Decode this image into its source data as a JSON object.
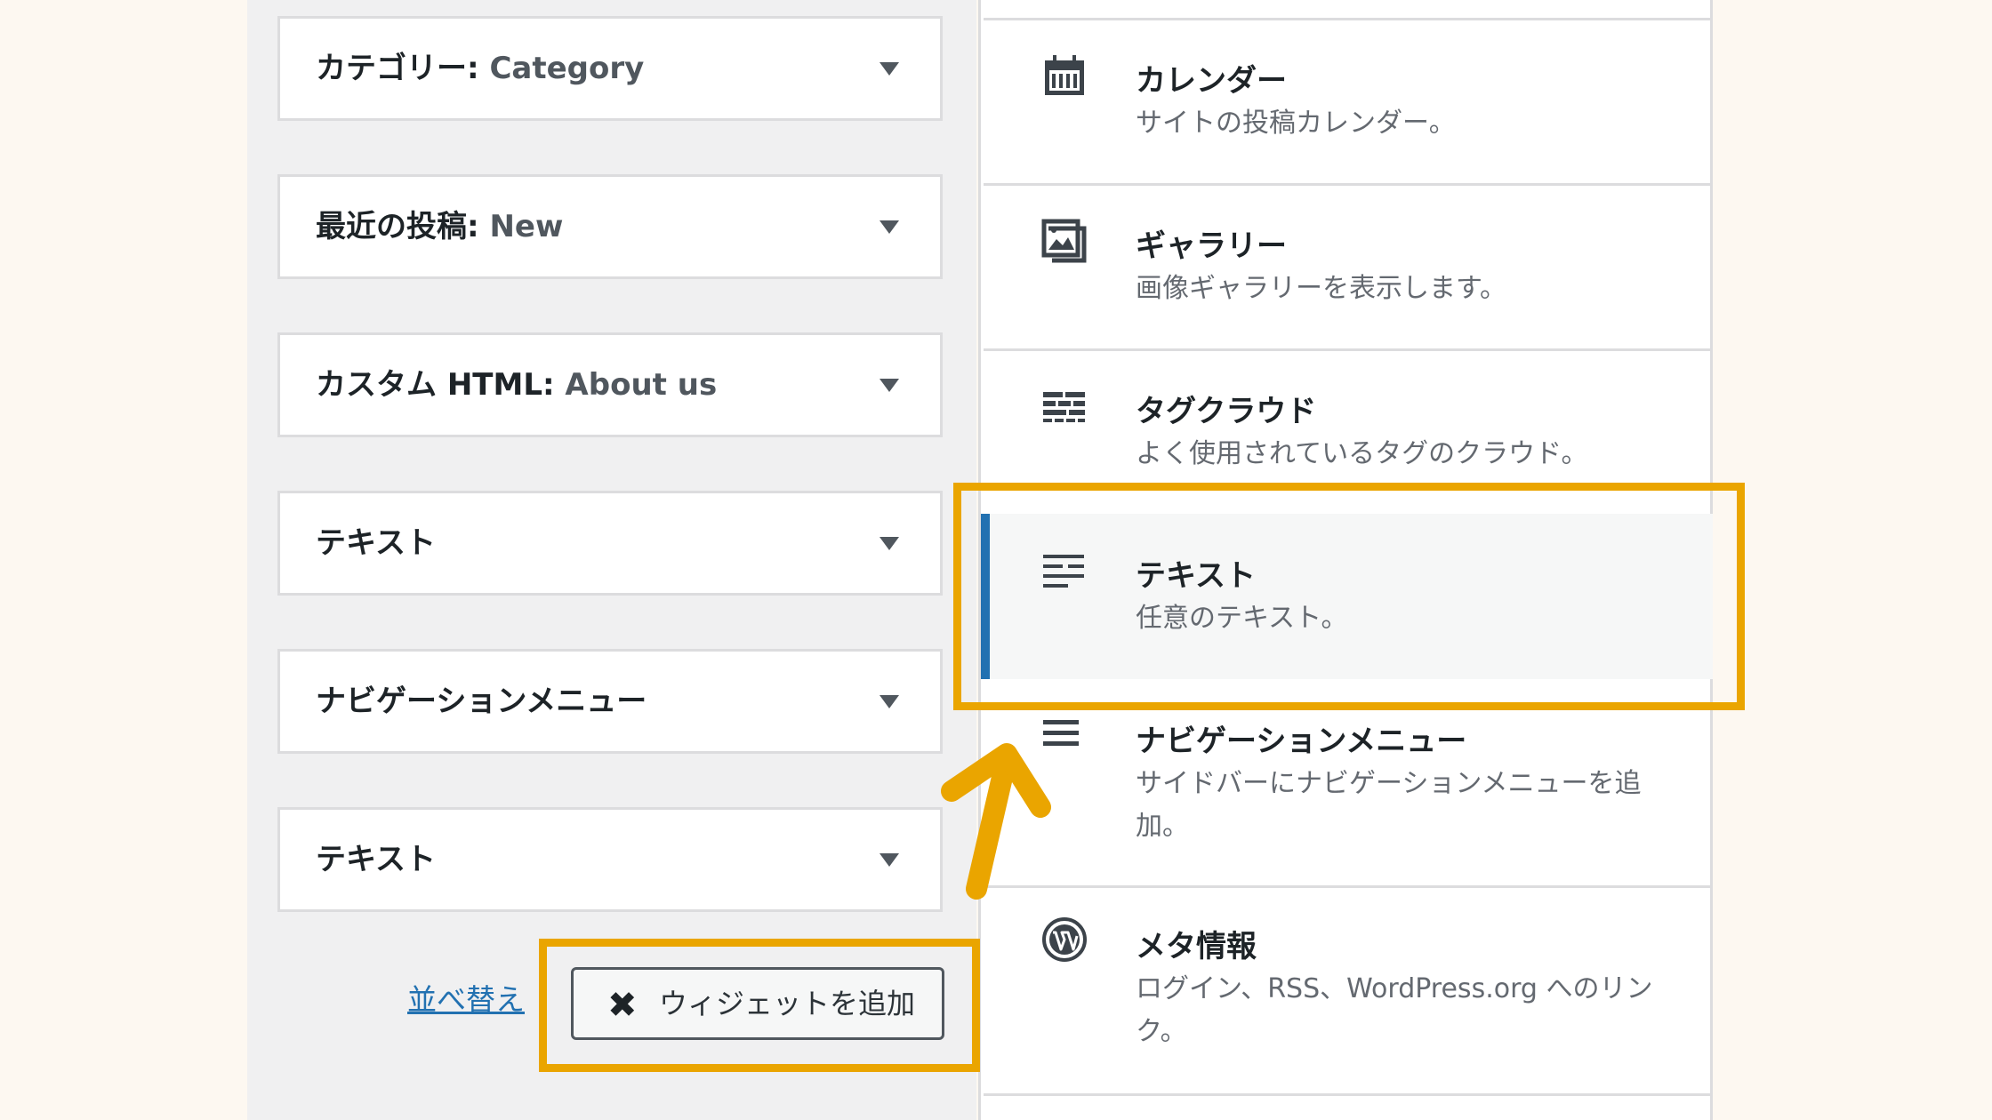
{
  "widgets": [
    {
      "type": "カテゴリー",
      "separator": ":",
      "title": " Category"
    },
    {
      "type": "最近の投稿",
      "separator": ":",
      "title": " New"
    },
    {
      "type": "カスタム HTML",
      "separator": ":",
      "title": " About us"
    },
    {
      "type": "テキスト",
      "separator": "",
      "title": ""
    },
    {
      "type": "ナビゲーションメニュー",
      "separator": "",
      "title": ""
    },
    {
      "type": "テキスト",
      "separator": "",
      "title": ""
    }
  ],
  "actions": {
    "reorder_label": "並べ替え",
    "add_widget_label": "ウィジェットを追加",
    "close_glyph": "✖"
  },
  "widget_choices": [
    {
      "icon": "calendar-icon",
      "name": "カレンダー",
      "desc": "サイトの投稿カレンダー。"
    },
    {
      "icon": "gallery-icon",
      "name": "ギャラリー",
      "desc": "画像ギャラリーを表示します。"
    },
    {
      "icon": "tag-cloud-icon",
      "name": "タグクラウド",
      "desc": "よく使用されているタグのクラウド。"
    },
    {
      "icon": "text-icon",
      "name": "テキスト",
      "desc": "任意のテキスト。",
      "selected": true
    },
    {
      "icon": "menu-icon",
      "name": "ナビゲーションメニュー",
      "desc": "サイドバーにナビゲーションメニューを追加。"
    },
    {
      "icon": "wordpress-icon",
      "name": "メタ情報",
      "desc": "ログイン、RSS、WordPress.org へのリンク。"
    }
  ],
  "colors": {
    "highlight": "#eaa500",
    "selected_accent": "#2271b1",
    "link": "#2271b1"
  }
}
